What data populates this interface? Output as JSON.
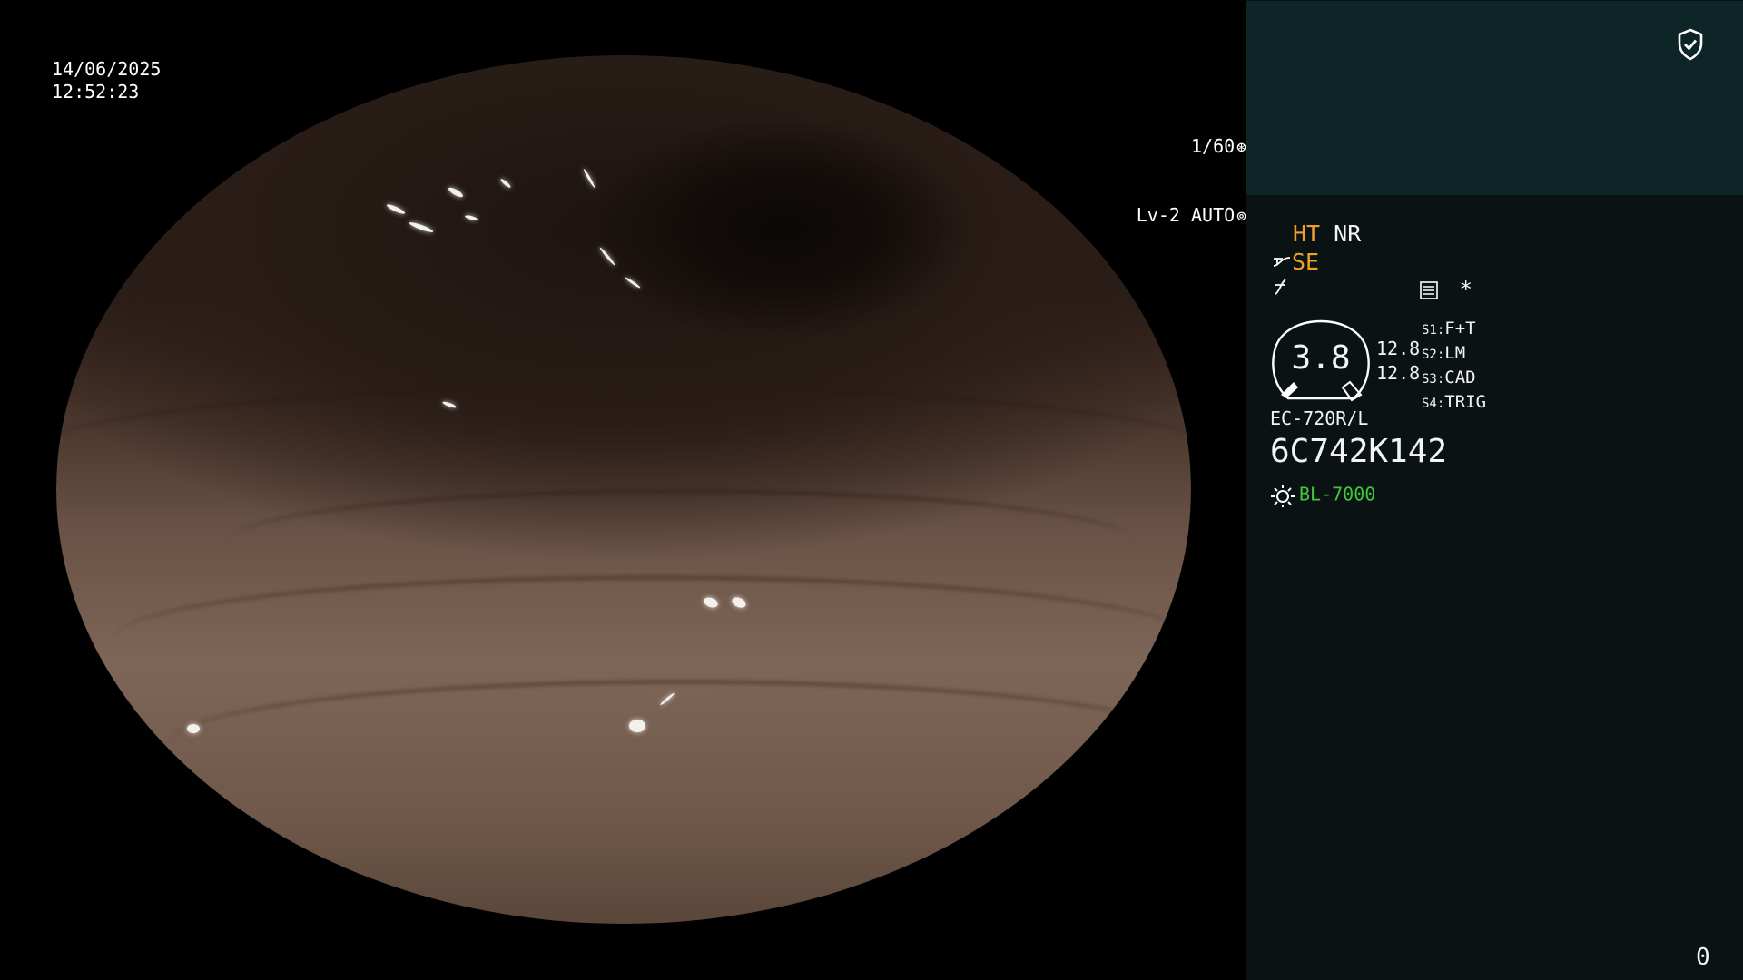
{
  "osd": {
    "date": "14/06/2025",
    "time": "12:52:23",
    "shutter": "1/60",
    "shutter_icon": "aperture-icon",
    "level": "Lv-2",
    "auto": "AUTO",
    "auto_icon": "iris-icon"
  },
  "panel": {
    "security_icon": "shield-check-icon",
    "modes": {
      "ht": "HT",
      "nr": "NR",
      "se": "SE"
    },
    "gauge": {
      "value": "3.8",
      "upper": "12.8",
      "lower": "12.8"
    },
    "switches": [
      {
        "key": "S1:",
        "value": "F+T"
      },
      {
        "key": "S2:",
        "value": "LM"
      },
      {
        "key": "S3:",
        "value": "CAD"
      },
      {
        "key": "S4:",
        "value": "TRIG"
      }
    ],
    "settings_star": "*",
    "scope_model": "EC-720R/L",
    "scope_serial": "6C742K142",
    "light_source": "BL-7000",
    "counter": "0"
  },
  "colors": {
    "orange": "#f0a028",
    "green": "#40c838",
    "panel_bg": "#0a1214",
    "panel_top_bg": "#0d2526"
  }
}
